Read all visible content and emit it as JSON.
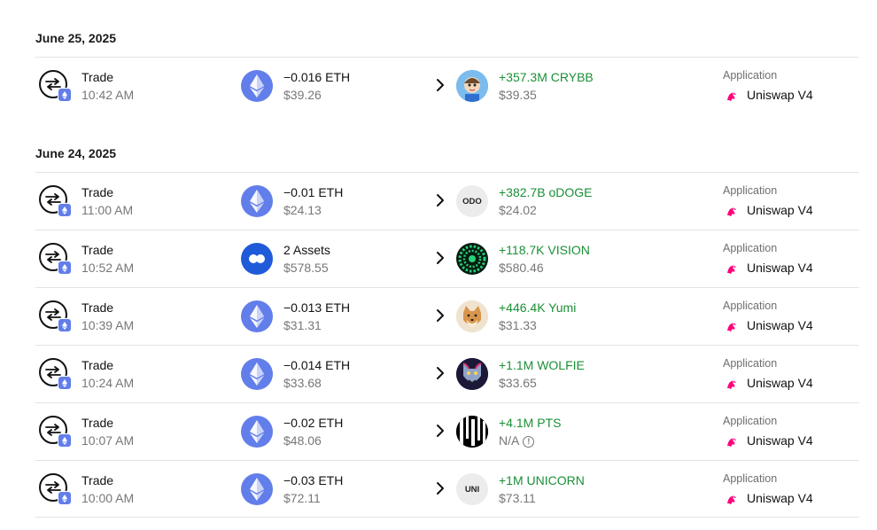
{
  "groups": [
    {
      "date": "June 25, 2025",
      "rows": [
        {
          "type": "Trade",
          "time": "10:42 AM",
          "out_amount": "−0.016 ETH",
          "out_value": "$39.26",
          "out_icon": "eth-icon",
          "in_amount": "+357.3M CRYBB",
          "in_value": "$39.35",
          "in_icon": "crybb-token-icon",
          "app_label": "Application",
          "app_name": "Uniswap V4"
        }
      ]
    },
    {
      "date": "June 24, 2025",
      "rows": [
        {
          "type": "Trade",
          "time": "11:00 AM",
          "out_amount": "−0.01 ETH",
          "out_value": "$24.13",
          "out_icon": "eth-icon",
          "in_amount": "+382.7B oDOGE",
          "in_value": "$24.02",
          "in_icon": "odoge-token-icon",
          "in_icon_text": "ODO",
          "app_label": "Application",
          "app_name": "Uniswap V4"
        },
        {
          "type": "Trade",
          "time": "10:52 AM",
          "out_amount": "2 Assets",
          "out_value": "$578.55",
          "out_icon": "multi-asset-icon",
          "in_amount": "+118.7K VISION",
          "in_value": "$580.46",
          "in_icon": "vision-token-icon",
          "app_label": "Application",
          "app_name": "Uniswap V4"
        },
        {
          "type": "Trade",
          "time": "10:39 AM",
          "out_amount": "−0.013 ETH",
          "out_value": "$31.31",
          "out_icon": "eth-icon",
          "in_amount": "+446.4K Yumi",
          "in_value": "$31.33",
          "in_icon": "yumi-token-icon",
          "app_label": "Application",
          "app_name": "Uniswap V4"
        },
        {
          "type": "Trade",
          "time": "10:24 AM",
          "out_amount": "−0.014 ETH",
          "out_value": "$33.68",
          "out_icon": "eth-icon",
          "in_amount": "+1.1M WOLFIE",
          "in_value": "$33.65",
          "in_icon": "wolfie-token-icon",
          "app_label": "Application",
          "app_name": "Uniswap V4"
        },
        {
          "type": "Trade",
          "time": "10:07 AM",
          "out_amount": "−0.02 ETH",
          "out_value": "$48.06",
          "out_icon": "eth-icon",
          "in_amount": "+4.1M PTS",
          "in_value": "N/A",
          "in_value_info": "!",
          "in_icon": "pts-token-icon",
          "app_label": "Application",
          "app_name": "Uniswap V4"
        },
        {
          "type": "Trade",
          "time": "10:00 AM",
          "out_amount": "−0.03 ETH",
          "out_value": "$72.11",
          "out_icon": "eth-icon",
          "in_amount": "+1M UNICORN",
          "in_value": "$73.11",
          "in_icon": "unicorn-token-icon",
          "in_icon_text": "UNI",
          "app_label": "Application",
          "app_name": "Uniswap V4"
        }
      ]
    }
  ],
  "colors": {
    "positive": "#1a8f36",
    "eth": "#627eea",
    "uniswap": "#ff007a"
  }
}
